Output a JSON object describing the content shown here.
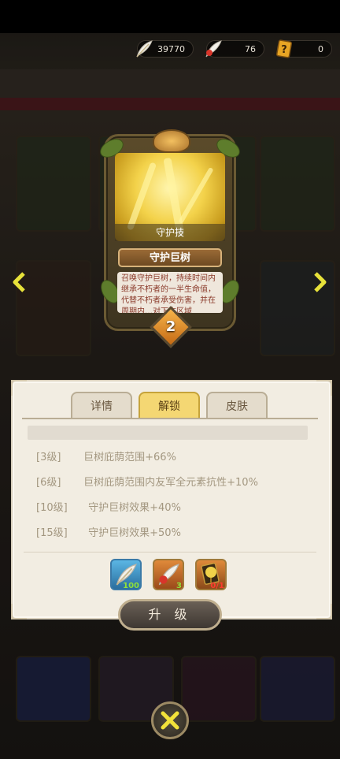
{
  "currencies": [
    {
      "icon": "white-feather-icon",
      "value": "39770"
    },
    {
      "icon": "red-feather-icon",
      "value": "76"
    },
    {
      "icon": "question-card-icon",
      "value": "0"
    }
  ],
  "skill_card": {
    "type_label": "守护技",
    "name": "守护巨树",
    "description": "召唤守护巨树，持续时间内继承不朽者的一半生命值，代替不朽者承受伤害，并在周期内…对下方区域",
    "level": "2"
  },
  "tabs": [
    {
      "label": "详情",
      "active": false
    },
    {
      "label": "解锁",
      "active": true
    },
    {
      "label": "皮肤",
      "active": false
    }
  ],
  "unlocks": [
    {
      "level": "[3级]",
      "effect": "巨树庇荫范围+66%"
    },
    {
      "level": "[6级]",
      "effect": "巨树庇荫范围内友军全元素抗性+10%"
    },
    {
      "level": "[10级]",
      "effect": "守护巨树效果+40%"
    },
    {
      "level": "[15级]",
      "effect": "守护巨树效果+50%"
    }
  ],
  "materials": [
    {
      "icon": "white-feather-icon",
      "count": "100",
      "count_color": "#8fe03a"
    },
    {
      "icon": "red-feather-icon",
      "count": "3",
      "count_color": "#8fe03a"
    },
    {
      "icon": "golden-tree-item-icon",
      "count": "0/1",
      "count_color": "#ff3b2f"
    }
  ],
  "upgrade_label": "升 级",
  "nav": {
    "left_arrow": "‹",
    "right_arrow": "›",
    "close": "✕"
  },
  "colors": {
    "accent": "#f4d773",
    "arrow": "#e7e23a"
  }
}
